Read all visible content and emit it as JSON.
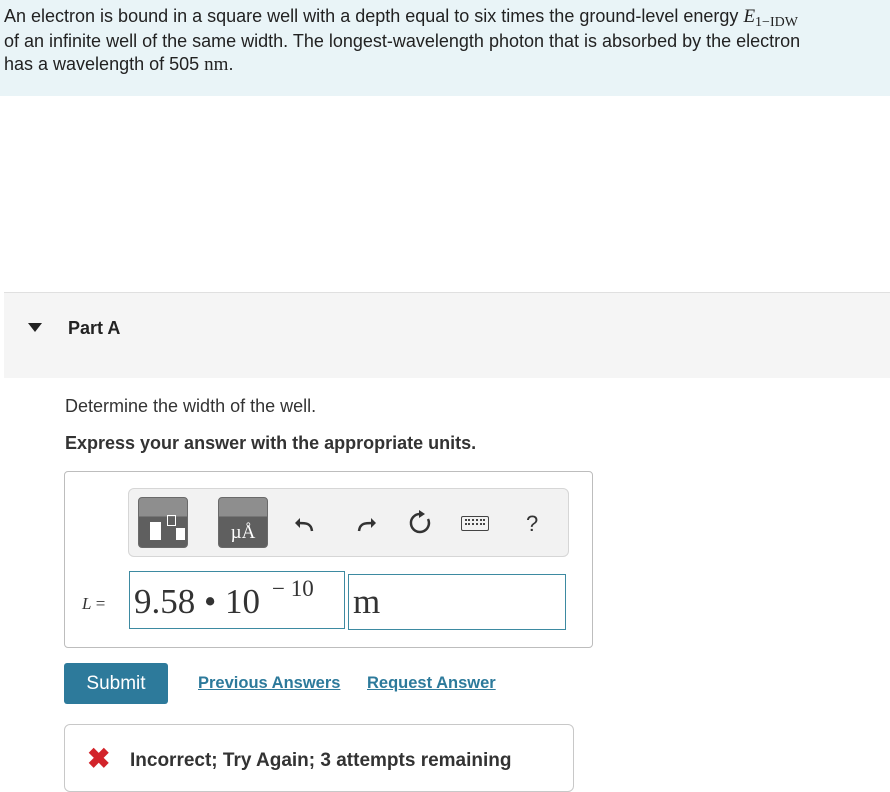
{
  "problem": {
    "line1_pre": "An electron is bound in a square well with a depth equal to six times the ground-level energy ",
    "energy_symbol": "E",
    "energy_subscript": "1−IDW",
    "line2": "of an infinite well of the same width. The longest-wavelength photon that is absorbed by the electron",
    "line3_pre": "has a wavelength of 505 ",
    "wavelength_unit": "nm",
    "line3_post": "."
  },
  "part": {
    "title": "Part A"
  },
  "question": {
    "prompt": "Determine the width of the well.",
    "instructions": "Express your answer with the appropriate units."
  },
  "toolbar": {
    "units_button_label": "µÅ",
    "help_label": "?"
  },
  "answer": {
    "variable": "L",
    "equals": "=",
    "mantissa": "9.58 • 10",
    "exponent": "− 10",
    "unit": "m"
  },
  "actions": {
    "submit_label": "Submit",
    "previous_answers_label": "Previous Answers",
    "request_answer_label": "Request Answer"
  },
  "feedback": {
    "icon": "x-icon",
    "message": "Incorrect; Try Again; 3 attempts remaining",
    "color": "#d2232a"
  },
  "colors": {
    "problem_background": "#e9f4f7",
    "accent": "#2d7a9b"
  }
}
